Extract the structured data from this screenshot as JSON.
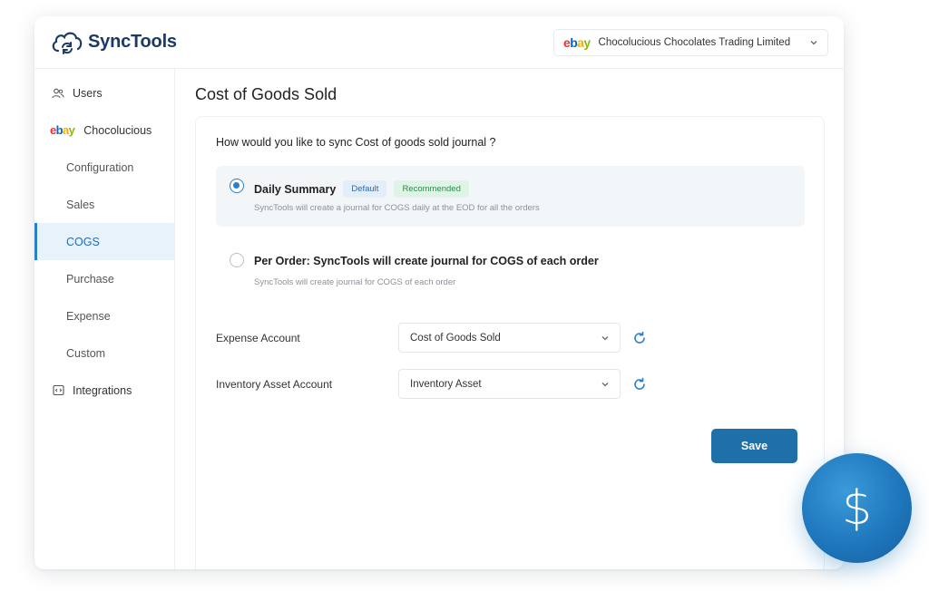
{
  "app": {
    "name": "SyncTools"
  },
  "header": {
    "store_logo_text": {
      "e": "e",
      "b": "b",
      "a": "a",
      "y": "y"
    },
    "store_name": "Chocolucious Chocolates Trading Limited"
  },
  "sidebar": {
    "users": "Users",
    "store": "Chocolucious",
    "configuration": "Configuration",
    "sales": "Sales",
    "cogs": "COGS",
    "purchase": "Purchase",
    "expense": "Expense",
    "custom": "Custom",
    "integrations": "Integrations"
  },
  "main": {
    "title": "Cost of Goods Sold",
    "question": "How would you like to sync Cost of goods sold journal ?",
    "options": [
      {
        "title": "Daily Summary",
        "badge_default": "Default",
        "badge_recommended": "Recommended",
        "desc": "SyncTools will create a journal for COGS daily at the EOD for all the orders",
        "selected": true
      },
      {
        "title": "Per Order: SyncTools will create journal for COGS of each order",
        "desc": "SyncTools will create journal for COGS of each order",
        "selected": false
      }
    ],
    "expense_account": {
      "label": "Expense Account",
      "value": "Cost of Goods Sold"
    },
    "inventory_account": {
      "label": "Inventory Asset Account",
      "value": "Inventory Asset"
    },
    "save_label": "Save"
  },
  "fab": {
    "symbol": "$"
  },
  "colors": {
    "accent": "#2a7fc9",
    "save": "#1f70a8",
    "active_bg": "#e8f2fb",
    "brand_text": "#1b3a66"
  }
}
